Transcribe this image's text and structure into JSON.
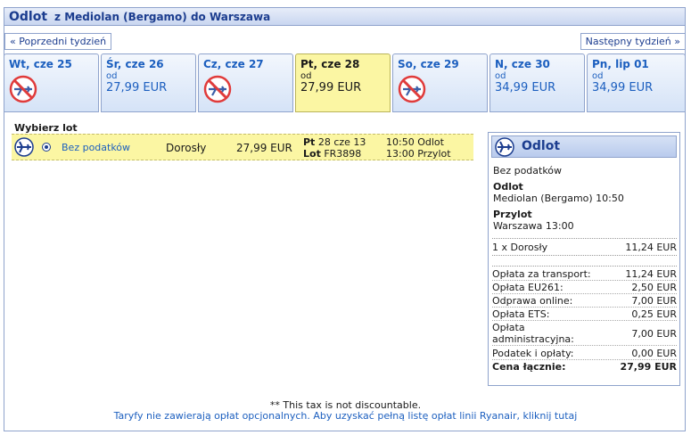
{
  "header": {
    "title": "Odlot",
    "route": "z Mediolan (Bergamo) do Warszawa"
  },
  "nav": {
    "prev": "« Poprzedni tydzień",
    "next": "Następny tydzień »"
  },
  "days": [
    {
      "label": "Wt, cze 25",
      "available": false
    },
    {
      "label": "Śr, cze 26",
      "od": "od",
      "price": "27,99 EUR",
      "available": true
    },
    {
      "label": "Cz, cze 27",
      "available": false
    },
    {
      "label": "Pt, cze 28",
      "od": "od",
      "price": "27,99 EUR",
      "available": true,
      "selected": true
    },
    {
      "label": "So, cze 29",
      "available": false
    },
    {
      "label": "N, cze 30",
      "od": "od",
      "price": "34,99 EUR",
      "available": true
    },
    {
      "label": "Pn, lip 01",
      "od": "od",
      "price": "34,99 EUR",
      "available": true
    }
  ],
  "flights": {
    "heading": "Wybierz lot",
    "row": {
      "fare": "Bez podatków",
      "pax": "Dorosły",
      "price": "27,99 EUR",
      "day_label": "Pt",
      "date": "28 cze 13",
      "flight_label": "Lot",
      "flight_no": "FR3898",
      "dep_time": "10:50 Odlot",
      "arr_time": "13:00 Przylot"
    }
  },
  "summary": {
    "title": "Odlot",
    "fare": "Bez podatków",
    "dep_label": "Odlot",
    "dep_value": "Mediolan (Bergamo) 10:50",
    "arr_label": "Przylot",
    "arr_value": "Warszawa 13:00",
    "pax_label": "1 x Dorosły",
    "pax_value": "11,24 EUR",
    "fees": [
      {
        "label": "Opłata za transport:",
        "value": "11,24 EUR"
      },
      {
        "label": "Opłata EU261:",
        "value": "2,50 EUR"
      },
      {
        "label": "Odprawa online:",
        "value": "7,00 EUR"
      },
      {
        "label": "Opłata ETS:",
        "value": "0,25 EUR"
      },
      {
        "label": "Opłata administracyjna:",
        "value": "7,00 EUR"
      },
      {
        "label": "Podatek i opłaty:",
        "value": "0,00 EUR"
      }
    ],
    "total_label": "Cena łącznie:",
    "total_value": "27,99 EUR"
  },
  "footer": {
    "note": "** This tax is not discountable.",
    "link": "Taryfy nie zawierają opłat opcjonalnych. Aby uzyskać pełną listę opłat linii Ryanair, kliknij tutaj"
  },
  "colors": {
    "accent": "#1c3d8f",
    "link": "#1c5fbf",
    "selected": "#fbf6a3",
    "no_flight": "#e03b3b"
  },
  "icons": {
    "plane": "plane-icon",
    "no_flight": "no-flight-icon"
  }
}
